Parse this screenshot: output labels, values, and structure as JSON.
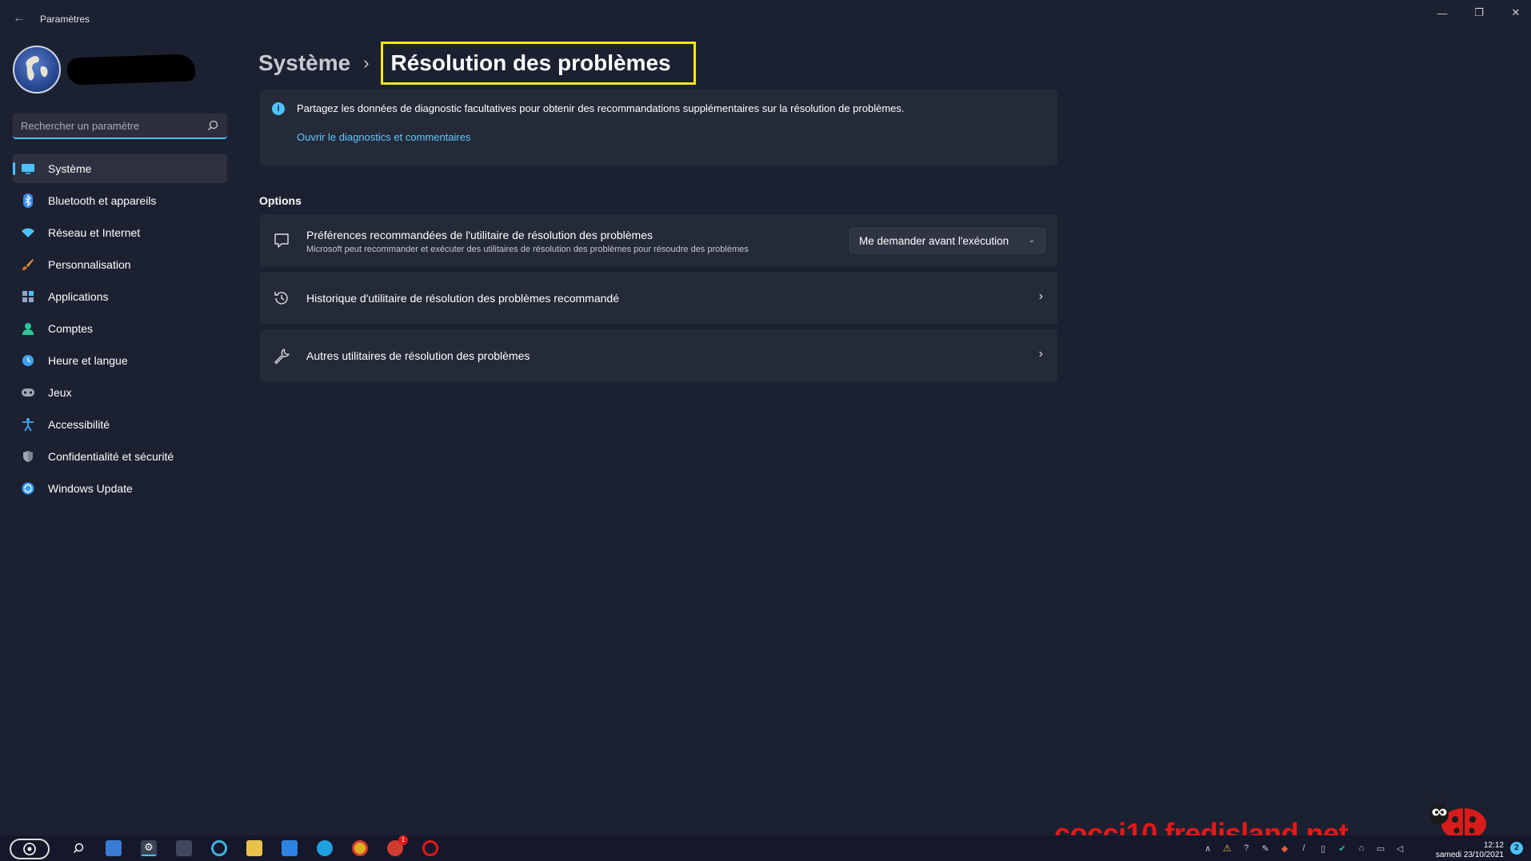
{
  "window": {
    "title": "Paramètres",
    "controls": {
      "minimize": "—",
      "maximize": "❐",
      "close": "✕"
    }
  },
  "search": {
    "placeholder": "Rechercher un paramètre"
  },
  "sidebar": {
    "items": [
      {
        "label": "Système",
        "icon": "monitor-icon",
        "color": "#4cc2ff",
        "active": true
      },
      {
        "label": "Bluetooth et appareils",
        "icon": "bluetooth-icon",
        "color": "#3b8cf5"
      },
      {
        "label": "Réseau et Internet",
        "icon": "wifi-icon",
        "color": "#4cc2ff"
      },
      {
        "label": "Personnalisation",
        "icon": "brush-icon",
        "color": "#e8a13a"
      },
      {
        "label": "Applications",
        "icon": "apps-icon",
        "color": "#8fa6c9"
      },
      {
        "label": "Comptes",
        "icon": "person-icon",
        "color": "#2fc39b"
      },
      {
        "label": "Heure et langue",
        "icon": "globe-clock-icon",
        "color": "#3fa0f0"
      },
      {
        "label": "Jeux",
        "icon": "gamepad-icon",
        "color": "#a0a6b4"
      },
      {
        "label": "Accessibilité",
        "icon": "accessibility-icon",
        "color": "#3fa7f5"
      },
      {
        "label": "Confidentialité et sécurité",
        "icon": "shield-icon",
        "color": "#a0a6b4"
      },
      {
        "label": "Windows Update",
        "icon": "update-icon",
        "color": "#3b9cf5"
      }
    ]
  },
  "breadcrumb": {
    "parent": "Système",
    "separator": "›",
    "current": "Résolution des problèmes"
  },
  "info": {
    "text": "Partagez les données de diagnostic facultatives pour obtenir des recommandations supplémentaires sur la résolution de problèmes.",
    "link": "Ouvrir le diagnostics et commentaires"
  },
  "options": {
    "section_title": "Options",
    "rows": [
      {
        "title": "Préférences recommandées de l'utilitaire de résolution des problèmes",
        "subtitle": "Microsoft peut recommander et exécuter des utilitaires de résolution des problèmes pour résoudre des problèmes",
        "dropdown_value": "Me demander avant l'exécution",
        "icon": "chat-bubble-icon"
      },
      {
        "title": "Historique d'utilitaire de résolution des problèmes recommandé",
        "icon": "history-icon"
      },
      {
        "title": "Autres utilitaires de résolution des problèmes",
        "icon": "wrench-icon"
      }
    ]
  },
  "watermark": "cocci10.fredisland.net",
  "taskbar": {
    "clock_time": "12:12",
    "clock_date": "samedi 23/10/2021",
    "notification_count": "2",
    "mail_badge": "1"
  },
  "colors": {
    "accent": "#4cc2ff",
    "highlight_border": "#f2e81a",
    "watermark": "#e31818"
  }
}
